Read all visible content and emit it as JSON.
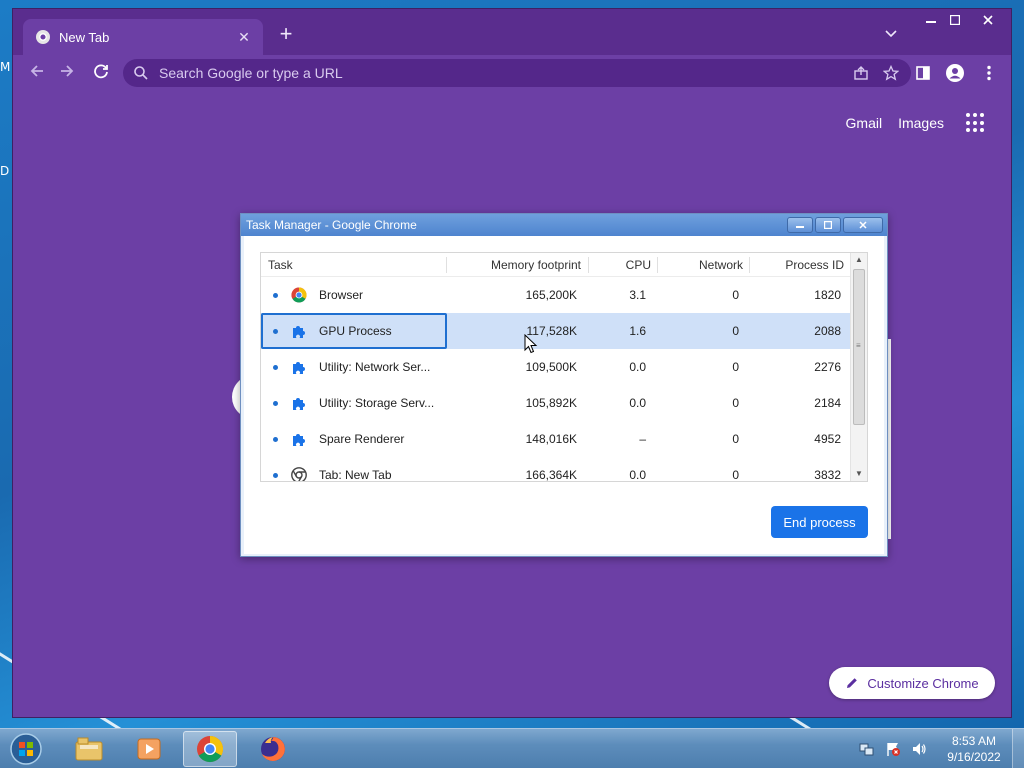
{
  "desktop": {
    "edge_letters": [
      "M",
      "D"
    ]
  },
  "chrome": {
    "tab": {
      "title": "New Tab",
      "close_icon": "close-icon"
    },
    "omnibox": {
      "placeholder": "Search Google or type a URL"
    },
    "ntp": {
      "gmail": "Gmail",
      "images": "Images",
      "customize": "Customize Chrome"
    },
    "theme_color": "#6c3fa5"
  },
  "task_manager": {
    "title": "Task Manager - Google Chrome",
    "columns": [
      "Task",
      "Memory footprint",
      "CPU",
      "Network",
      "Process ID"
    ],
    "rows": [
      {
        "icon": "chrome-icon",
        "task": "Browser",
        "memory": "165,200K",
        "cpu": "3.1",
        "network": "0",
        "pid": "1820",
        "selected": false
      },
      {
        "icon": "puzzle-icon",
        "task": "GPU Process",
        "memory": "117,528K",
        "cpu": "1.6",
        "network": "0",
        "pid": "2088",
        "selected": true
      },
      {
        "icon": "puzzle-icon",
        "task": "Utility: Network Ser...",
        "memory": "109,500K",
        "cpu": "0.0",
        "network": "0",
        "pid": "2276",
        "selected": false
      },
      {
        "icon": "puzzle-icon",
        "task": "Utility: Storage Serv...",
        "memory": "105,892K",
        "cpu": "0.0",
        "network": "0",
        "pid": "2184",
        "selected": false
      },
      {
        "icon": "puzzle-icon",
        "task": "Spare Renderer",
        "memory": "148,016K",
        "cpu": "–",
        "network": "0",
        "pid": "4952",
        "selected": false
      },
      {
        "icon": "chrome-icon",
        "task": "Tab: New Tab",
        "memory": "166,364K",
        "cpu": "0.0",
        "network": "0",
        "pid": "3832",
        "selected": false
      }
    ],
    "end_process": "End process"
  },
  "taskbar": {
    "apps": [
      "explorer-icon",
      "media-player-icon",
      "chrome-icon",
      "firefox-icon"
    ],
    "clock": {
      "time": "8:53 AM",
      "date": "9/16/2022"
    }
  }
}
